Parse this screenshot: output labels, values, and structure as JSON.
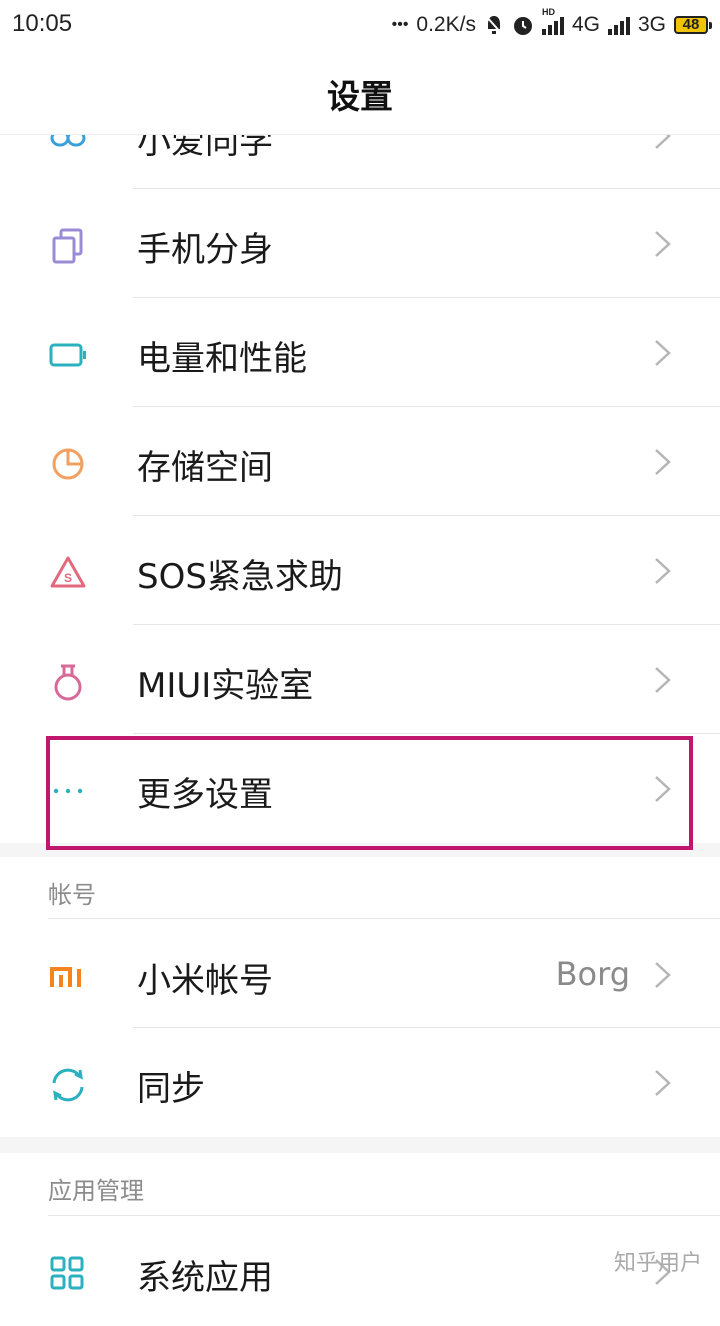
{
  "status_bar": {
    "time": "10:05",
    "more_dots": "•••",
    "net_speed": "0.2K/s",
    "hd": "HD",
    "net1": "4G",
    "net2": "3G",
    "battery": "48"
  },
  "header": {
    "title": "设置"
  },
  "items_top": [
    {
      "label": "小爱同学",
      "icon": "xiaoai-icon"
    },
    {
      "label": "手机分身",
      "icon": "dual-apps-icon"
    },
    {
      "label": "电量和性能",
      "icon": "battery-icon"
    },
    {
      "label": "存储空间",
      "icon": "storage-pie-icon"
    },
    {
      "label": "SOS紧急求助",
      "icon": "sos-icon"
    },
    {
      "label": "MIUI实验室",
      "icon": "lab-flask-icon"
    },
    {
      "label": "更多设置",
      "icon": "more-dots-icon"
    }
  ],
  "sections": {
    "account": {
      "title": "帐号",
      "items": [
        {
          "label": "小米帐号",
          "value": "Borg",
          "icon": "mi-logo-icon"
        },
        {
          "label": "同步",
          "icon": "sync-icon"
        }
      ]
    },
    "apps": {
      "title": "应用管理",
      "items": [
        {
          "label": "系统应用",
          "icon": "grid-apps-icon"
        }
      ]
    }
  },
  "watermark": "知乎用户",
  "colors": {
    "highlight": "#c0166d",
    "chevron": "#b5b5b5",
    "mi_orange": "#f5841f",
    "teal": "#2bb0bf"
  }
}
